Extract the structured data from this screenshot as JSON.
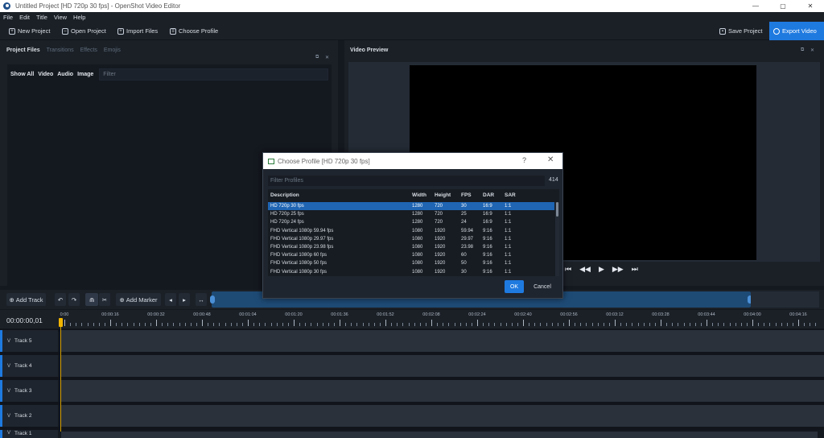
{
  "window": {
    "title": "Untitled Project [HD 720p 30 fps] - OpenShot Video Editor",
    "minimize": "—",
    "maximize": "▢",
    "close": "✕"
  },
  "menu": [
    "File",
    "Edit",
    "Title",
    "View",
    "Help"
  ],
  "toolbar": {
    "new_project": "New Project",
    "open_project": "Open Project",
    "import_files": "Import Files",
    "choose_profile": "Choose Profile",
    "save_project": "Save Project",
    "export_video": "Export Video"
  },
  "left_panel": {
    "tabs": [
      "Project Files",
      "Transitions",
      "Effects",
      "Emojis"
    ],
    "filters": [
      "Show All",
      "Video",
      "Audio",
      "Image"
    ],
    "filter_placeholder": "Filter"
  },
  "right_panel": {
    "title": "Video Preview",
    "transport": [
      "⏮",
      "◀◀",
      "▶",
      "▶▶",
      "⏭"
    ]
  },
  "panel_controls": {
    "float": "⧉",
    "close": "✕"
  },
  "timeline": {
    "add_track": "Add Track",
    "add_marker": "Add Marker",
    "timecode": "00:00:00,01",
    "ruler": [
      "0:00",
      "00:00:16",
      "00:00:32",
      "00:00:48",
      "00:01:04",
      "00:01:20",
      "00:01:36",
      "00:01:52",
      "00:02:08",
      "00:02:24",
      "00:02:40",
      "00:02:56",
      "00:03:12",
      "00:03:28",
      "00:03:44",
      "00:04:00",
      "00:04:16"
    ],
    "tracks": [
      "Track 5",
      "Track 4",
      "Track 3",
      "Track 2",
      "Track 1"
    ]
  },
  "dialog": {
    "title": "Choose Profile [HD 720p 30 fps]",
    "help": "?",
    "close": "✕",
    "filter_placeholder": "Filter Profiles",
    "count": "414",
    "columns": [
      "Description",
      "Width",
      "Height",
      "FPS",
      "DAR",
      "SAR"
    ],
    "rows": [
      [
        "HD 720p 30 fps",
        "1280",
        "720",
        "30",
        "16:9",
        "1:1"
      ],
      [
        "HD 720p 25 fps",
        "1280",
        "720",
        "25",
        "16:9",
        "1:1"
      ],
      [
        "HD 720p 24 fps",
        "1280",
        "720",
        "24",
        "16:9",
        "1:1"
      ],
      [
        "FHD Vertical 1080p 59.94 fps",
        "1080",
        "1920",
        "59.94",
        "9:16",
        "1:1"
      ],
      [
        "FHD Vertical 1080p 29.97 fps",
        "1080",
        "1920",
        "29.97",
        "9:16",
        "1:1"
      ],
      [
        "FHD Vertical 1080p 23.98 fps",
        "1080",
        "1920",
        "23.98",
        "9:16",
        "1:1"
      ],
      [
        "FHD Vertical 1080p 60 fps",
        "1080",
        "1920",
        "60",
        "9:16",
        "1:1"
      ],
      [
        "FHD Vertical 1080p 50 fps",
        "1080",
        "1920",
        "50",
        "9:16",
        "1:1"
      ],
      [
        "FHD Vertical 1080p 30 fps",
        "1080",
        "1920",
        "30",
        "9:16",
        "1:1"
      ]
    ],
    "ok": "OK",
    "cancel": "Cancel"
  },
  "colors": {
    "accent": "#1f7ae0",
    "playhead": "#f0b400",
    "selection": "#1f65b3"
  }
}
